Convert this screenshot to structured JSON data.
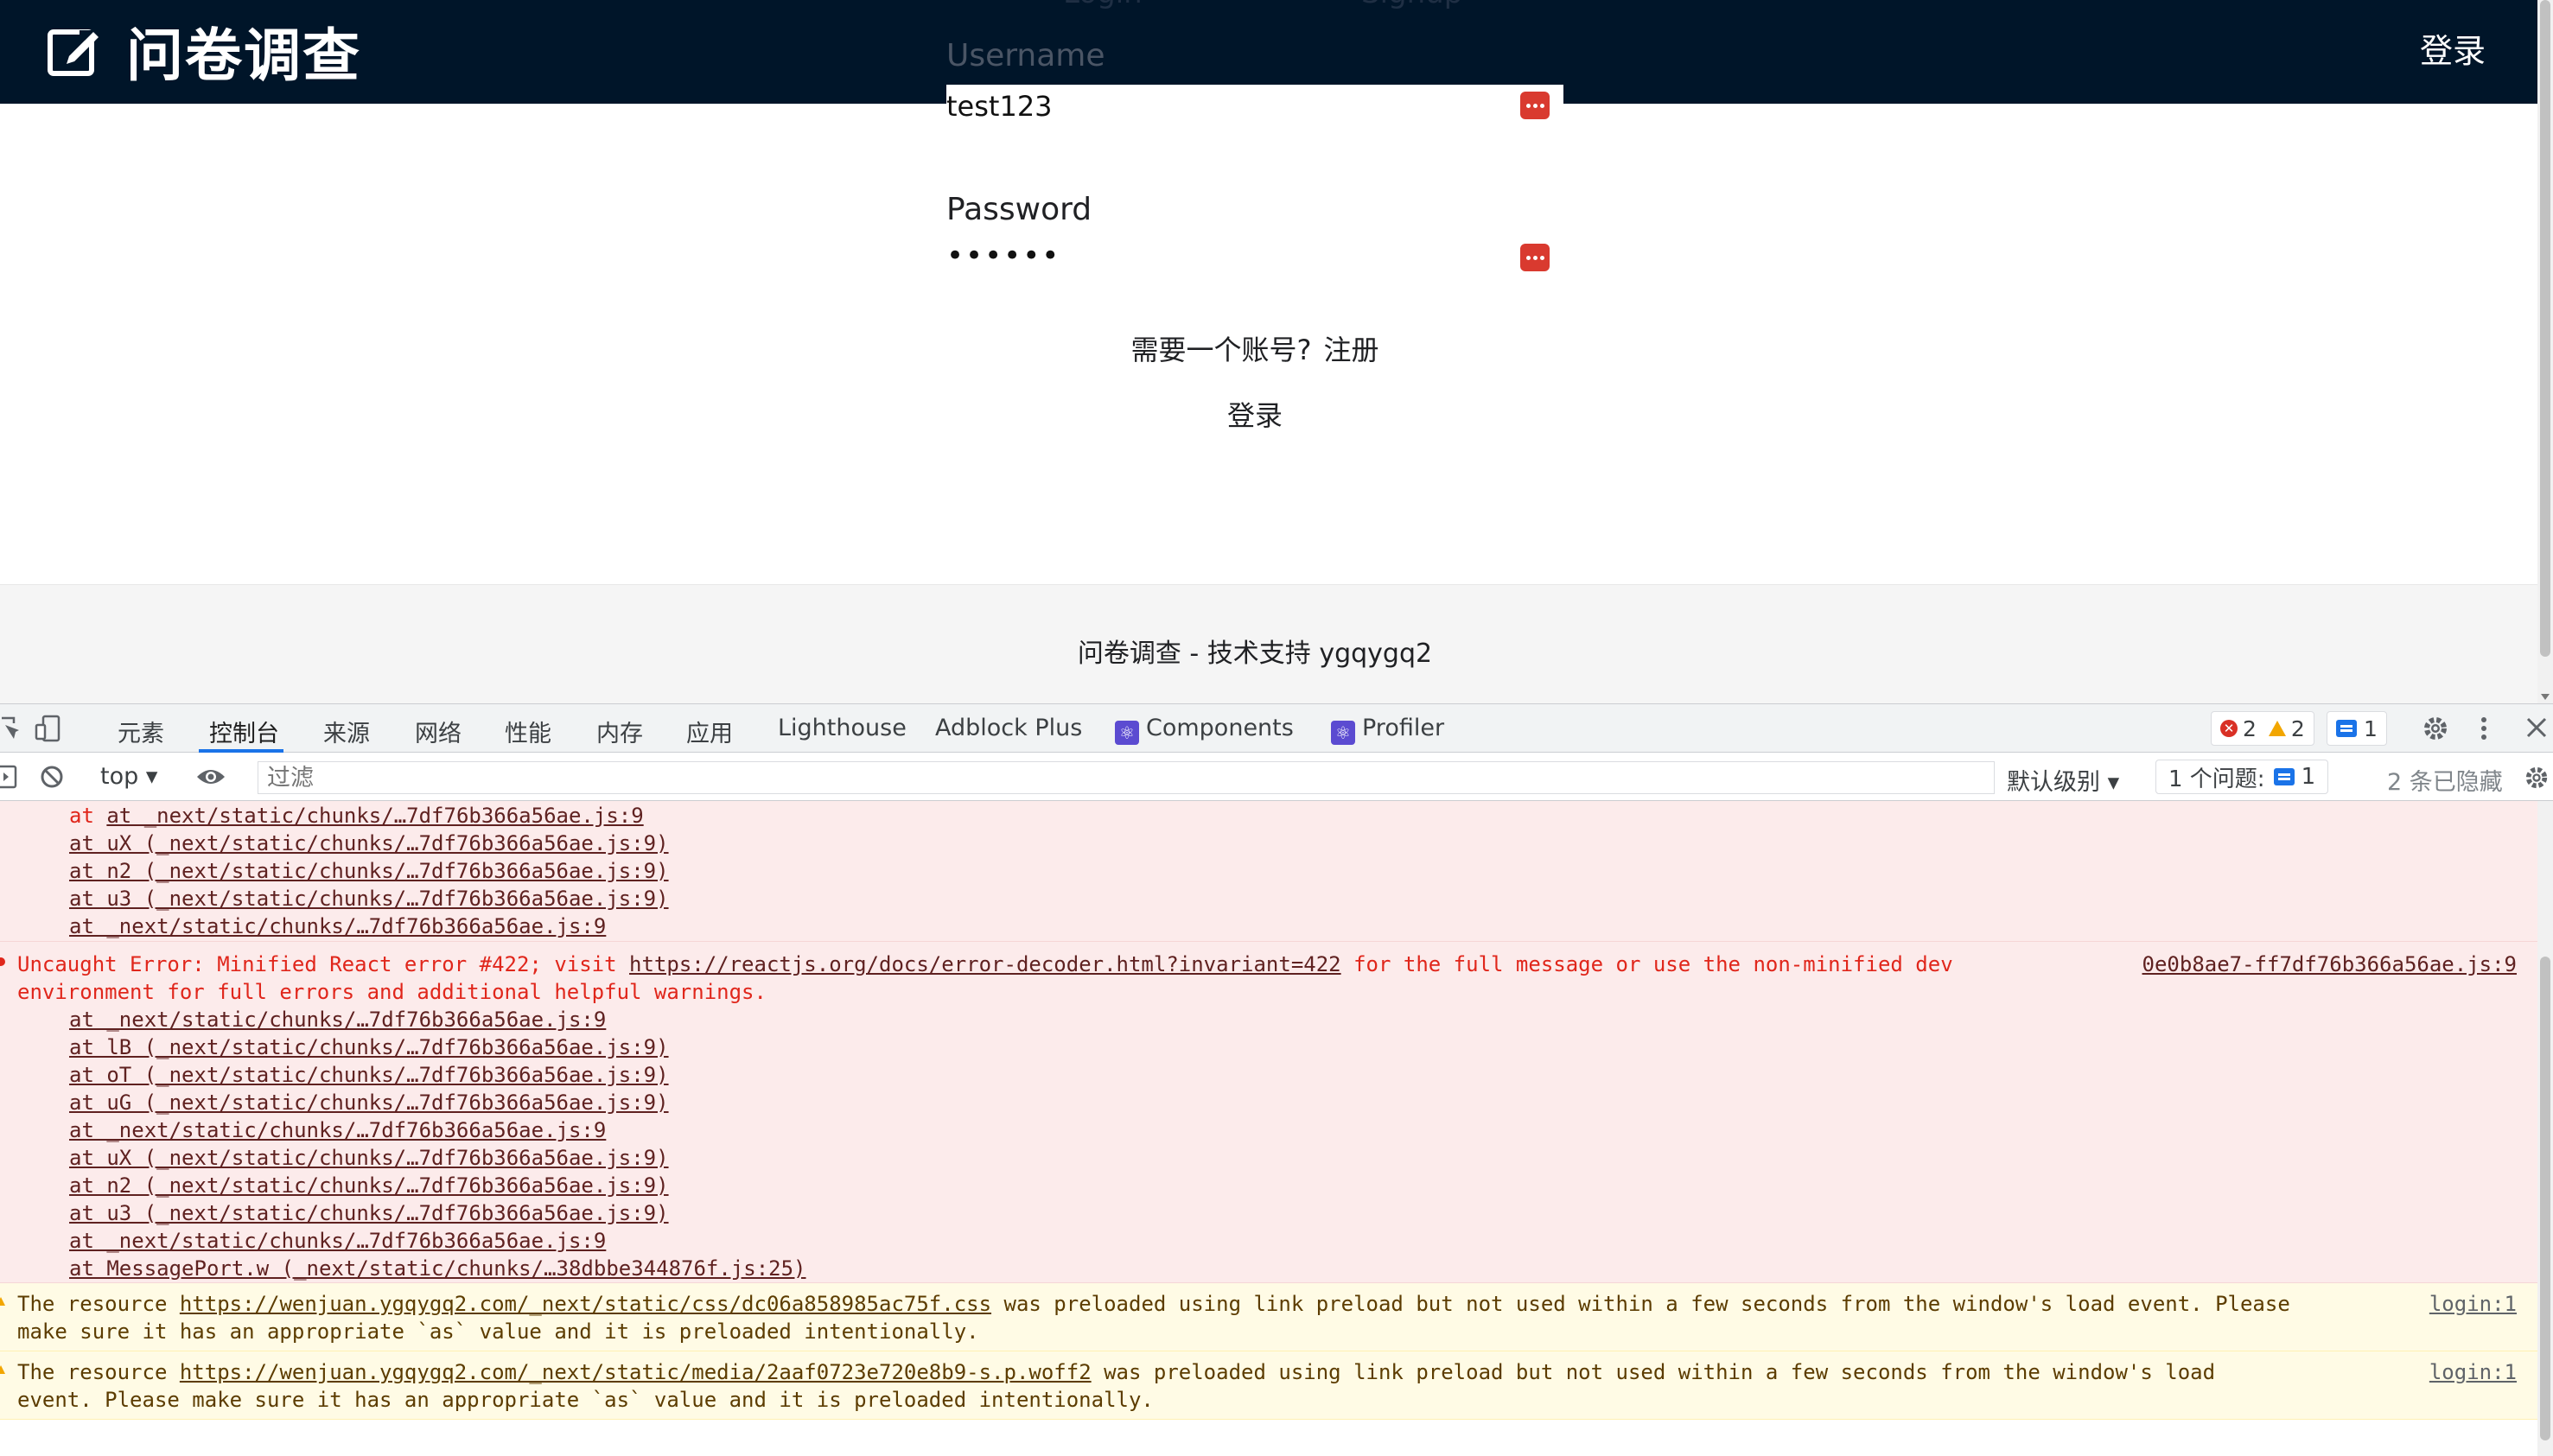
{
  "site": {
    "title": "问卷调查",
    "header_login": "登录",
    "ghost_tabs": [
      "Login",
      "Signup"
    ],
    "username_label": "Username",
    "username_value": "test123",
    "password_label": "Password",
    "password_dots": "••••••",
    "signup_prompt": "需要一个账号?",
    "signup_link": "注册",
    "login_button": "登录",
    "footer": "问卷调查 - 技术支持 ygqygq2"
  },
  "devtools": {
    "tabs": [
      "元素",
      "控制台",
      "来源",
      "网络",
      "性能",
      "内存",
      "应用",
      "Lighthouse",
      "Adblock Plus",
      "Components",
      "Profiler"
    ],
    "active_tab": "控制台",
    "error_count": "2",
    "warning_count": "2",
    "message_count": "1",
    "context": "top",
    "filter_placeholder": "过滤",
    "levels": "默认级别",
    "issues_label": "1 个问题:",
    "issues_count": "1",
    "hidden": "2 条已隐藏",
    "colors": {
      "error_bg": "#fcebeb",
      "error_text": "#e0261b",
      "warn_bg": "#fffbe5",
      "accent": "#1a73e8"
    }
  },
  "console": {
    "stack_top": [
      "at _next/static/chunks/…7df76b366a56ae.js:9",
      "at uX (_next/static/chunks/…7df76b366a56ae.js:9)",
      "at n2 (_next/static/chunks/…7df76b366a56ae.js:9)",
      "at u3 (_next/static/chunks/…7df76b366a56ae.js:9)",
      "at _next/static/chunks/…7df76b366a56ae.js:9"
    ],
    "error2": {
      "prefix": "Uncaught Error: Minified React error #422; visit ",
      "url": "https://reactjs.org/docs/error-decoder.html?invariant=422",
      "suffix": " for the full message or use the non-minified dev",
      "line2": "environment for full errors and additional helpful warnings.",
      "source": "0e0b8ae7-ff7df76b366a56ae.js:9",
      "stack": [
        "at _next/static/chunks/…7df76b366a56ae.js:9",
        "at lB (_next/static/chunks/…7df76b366a56ae.js:9)",
        "at oT (_next/static/chunks/…7df76b366a56ae.js:9)",
        "at uG (_next/static/chunks/…7df76b366a56ae.js:9)",
        "at _next/static/chunks/…7df76b366a56ae.js:9",
        "at uX (_next/static/chunks/…7df76b366a56ae.js:9)",
        "at n2 (_next/static/chunks/…7df76b366a56ae.js:9)",
        "at u3 (_next/static/chunks/…7df76b366a56ae.js:9)",
        "at _next/static/chunks/…7df76b366a56ae.js:9",
        "at MessagePort.w (_next/static/chunks/…38dbbe344876f.js:25)"
      ]
    },
    "warn1": {
      "prefix": "The resource ",
      "url": "https://wenjuan.ygqygq2.com/_next/static/css/dc06a858985ac75f.css",
      "suffix": " was preloaded using link preload but not used within a few seconds from the window's load event. Please",
      "line2": "make sure it has an appropriate `as` value and it is preloaded intentionally.",
      "source": "login:1"
    },
    "warn2": {
      "prefix": "The resource ",
      "url": "https://wenjuan.ygqygq2.com/_next/static/media/2aaf0723e720e8b9-s.p.woff2",
      "suffix": " was preloaded using link preload but not used within a few seconds from the window's load",
      "line2": "event. Please make sure it has an appropriate `as` value and it is preloaded intentionally.",
      "source": "login:1"
    }
  }
}
